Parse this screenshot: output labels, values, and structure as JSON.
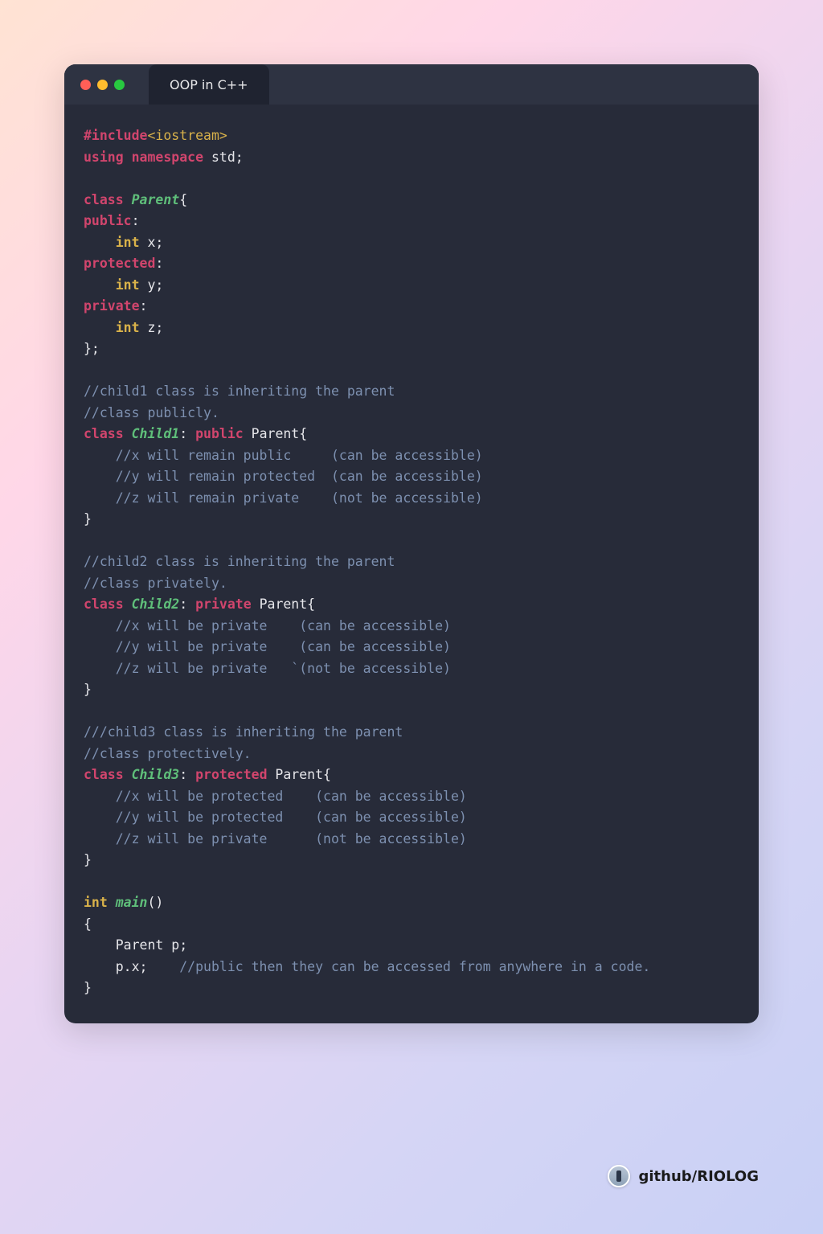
{
  "tab_title": "OOP in C++",
  "colors": {
    "window_bg": "#272b39",
    "titlebar_bg": "#2e3342",
    "tab_bg": "#1f2330",
    "dot_red": "#ff5f57",
    "dot_yellow": "#febc2e",
    "dot_green": "#28c840",
    "keyword": "#d1456d",
    "classname": "#5fbf7a",
    "type": "#d9b24a",
    "comment": "#7d90b0",
    "text": "#e6e6ea"
  },
  "code": {
    "l1_include": "#include",
    "l1_header": "<iostream>",
    "l2_using": "using",
    "l2_namespace": "namespace",
    "l2_std": " std;",
    "kw_class": "class",
    "cls_parent": "Parent",
    "brace_open": "{",
    "kw_public": "public",
    "colon": ":",
    "kw_int": "int",
    "var_x": " x;",
    "kw_protected": "protected",
    "var_y": " y;",
    "kw_private": "private",
    "var_z": " z;",
    "brace_close_semi": "};",
    "c_child1a": "//child1 class is inheriting the parent",
    "c_child1b": "//class publicly.",
    "cls_child1": "Child1",
    "inherit_public": " Parent{",
    "c1_x": "    //x will remain public     (can be accessible)",
    "c1_y": "    //y will remain protected  (can be accessible)",
    "c1_z": "    //z will remain private    (not be accessible)",
    "brace_close": "}",
    "c_child2a": "//child2 class is inheriting the parent",
    "c_child2b": "//class privately.",
    "cls_child2": "Child2",
    "c2_x": "    //x will be private    (can be accessible)",
    "c2_y": "    //y will be private    (can be accessible)",
    "c2_z": "    //z will be private   `(not be accessible)",
    "c_child3a": "///child3 class is inheriting the parent",
    "c_child3b": "//class protectively.",
    "cls_child3": "Child3",
    "c3_x": "    //x will be protected    (can be accessible)",
    "c3_y": "    //y will be protected    (can be accessible)",
    "c3_z": "    //z will be private      (not be accessible)",
    "fn_main": "main",
    "main_paren": "()",
    "main_parent_p": "    Parent p;",
    "main_px": "    p.x;",
    "main_px_cmt": "    //public then they can be accessed from anywhere in a code."
  },
  "credit": {
    "text": "github/RIOLOG"
  }
}
